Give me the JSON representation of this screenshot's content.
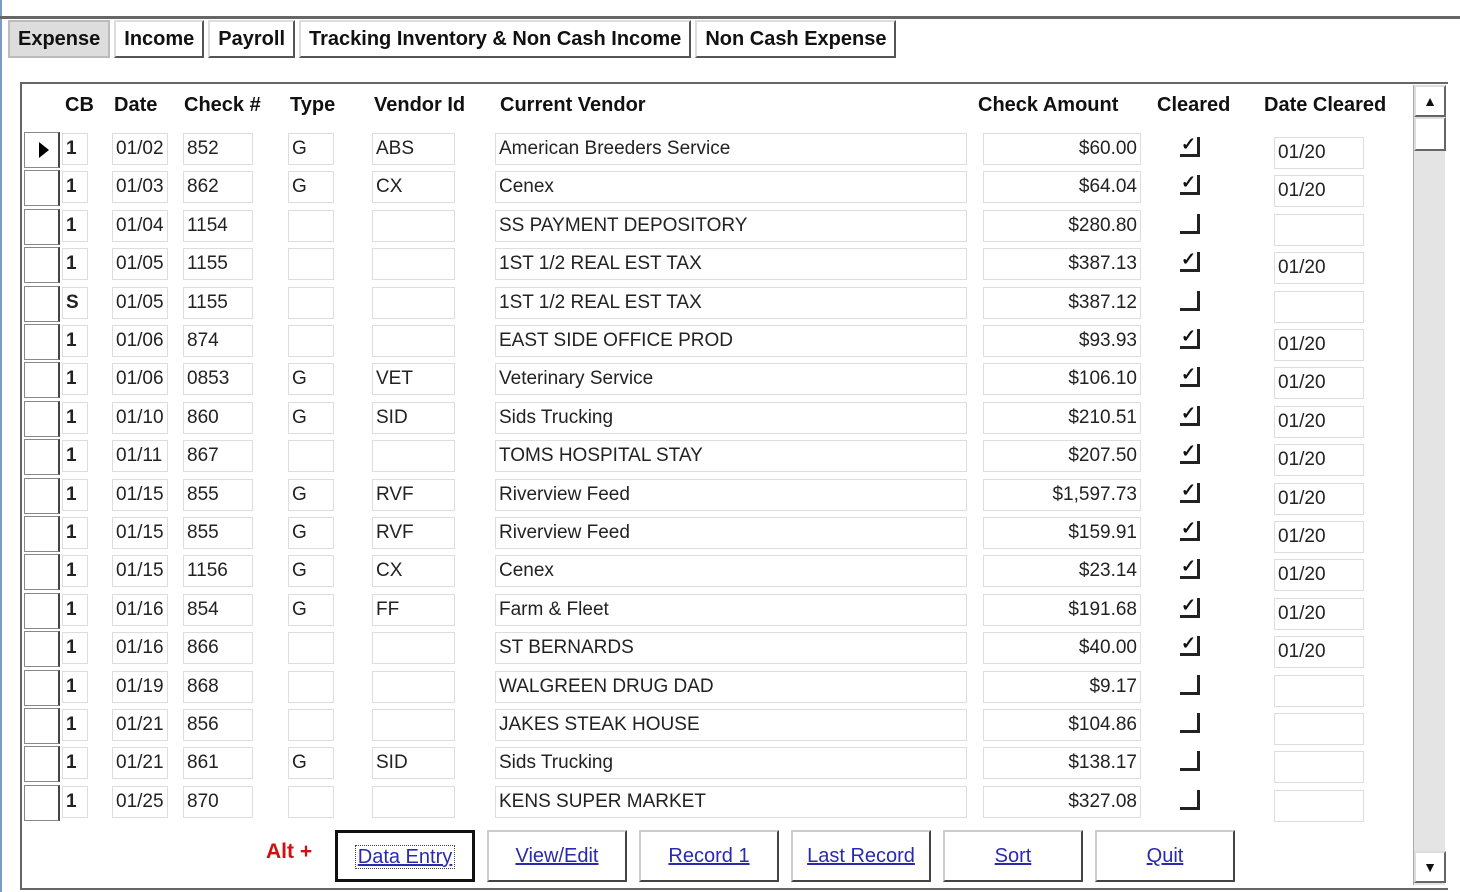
{
  "tabs": [
    "Expense",
    "Income",
    "Payroll",
    "Tracking Inventory & Non Cash Income",
    "Non Cash Expense"
  ],
  "columns": [
    "CB",
    "Date",
    "Check #",
    "Type",
    "Vendor Id",
    "Current Vendor",
    "Check Amount",
    "Cleared",
    "Date Cleared"
  ],
  "rows": [
    {
      "cb": "1",
      "date": "01/02",
      "check": "852",
      "type": "G",
      "vendor_id": "ABS",
      "vendor": "American Breeders Service",
      "amount": "$60.00",
      "cleared": true,
      "date_cleared": "01/20"
    },
    {
      "cb": "1",
      "date": "01/03",
      "check": "862",
      "type": "G",
      "vendor_id": "CX",
      "vendor": "Cenex",
      "amount": "$64.04",
      "cleared": true,
      "date_cleared": "01/20"
    },
    {
      "cb": "1",
      "date": "01/04",
      "check": "1154",
      "type": "",
      "vendor_id": "",
      "vendor": "SS PAYMENT DEPOSITORY",
      "amount": "$280.80",
      "cleared": false,
      "date_cleared": ""
    },
    {
      "cb": "1",
      "date": "01/05",
      "check": "1155",
      "type": "",
      "vendor_id": "",
      "vendor": "1ST 1/2 REAL EST TAX",
      "amount": "$387.13",
      "cleared": true,
      "date_cleared": "01/20"
    },
    {
      "cb": "S",
      "date": "01/05",
      "check": "1155",
      "type": "",
      "vendor_id": "",
      "vendor": "1ST 1/2 REAL EST TAX",
      "amount": "$387.12",
      "cleared": false,
      "date_cleared": ""
    },
    {
      "cb": "1",
      "date": "01/06",
      "check": "874",
      "type": "",
      "vendor_id": "",
      "vendor": "EAST SIDE OFFICE PROD",
      "amount": "$93.93",
      "cleared": true,
      "date_cleared": "01/20"
    },
    {
      "cb": "1",
      "date": "01/06",
      "check": "0853",
      "type": "G",
      "vendor_id": "VET",
      "vendor": "Veterinary Service",
      "amount": "$106.10",
      "cleared": true,
      "date_cleared": "01/20"
    },
    {
      "cb": "1",
      "date": "01/10",
      "check": "860",
      "type": "G",
      "vendor_id": "SID",
      "vendor": "Sids Trucking",
      "amount": "$210.51",
      "cleared": true,
      "date_cleared": "01/20"
    },
    {
      "cb": "1",
      "date": "01/11",
      "check": "867",
      "type": "",
      "vendor_id": "",
      "vendor": "TOMS HOSPITAL STAY",
      "amount": "$207.50",
      "cleared": true,
      "date_cleared": "01/20"
    },
    {
      "cb": "1",
      "date": "01/15",
      "check": "855",
      "type": "G",
      "vendor_id": "RVF",
      "vendor": "Riverview Feed",
      "amount": "$1,597.73",
      "cleared": true,
      "date_cleared": "01/20"
    },
    {
      "cb": "1",
      "date": "01/15",
      "check": "855",
      "type": "G",
      "vendor_id": "RVF",
      "vendor": "Riverview Feed",
      "amount": "$159.91",
      "cleared": true,
      "date_cleared": "01/20"
    },
    {
      "cb": "1",
      "date": "01/15",
      "check": "1156",
      "type": "G",
      "vendor_id": "CX",
      "vendor": "Cenex",
      "amount": "$23.14",
      "cleared": true,
      "date_cleared": "01/20"
    },
    {
      "cb": "1",
      "date": "01/16",
      "check": "854",
      "type": "G",
      "vendor_id": "FF",
      "vendor": "Farm & Fleet",
      "amount": "$191.68",
      "cleared": true,
      "date_cleared": "01/20"
    },
    {
      "cb": "1",
      "date": "01/16",
      "check": "866",
      "type": "",
      "vendor_id": "",
      "vendor": "ST BERNARDS",
      "amount": "$40.00",
      "cleared": true,
      "date_cleared": "01/20"
    },
    {
      "cb": "1",
      "date": "01/19",
      "check": "868",
      "type": "",
      "vendor_id": "",
      "vendor": "WALGREEN DRUG DAD",
      "amount": "$9.17",
      "cleared": false,
      "date_cleared": ""
    },
    {
      "cb": "1",
      "date": "01/21",
      "check": "856",
      "type": "",
      "vendor_id": "",
      "vendor": "JAKES STEAK HOUSE",
      "amount": "$104.86",
      "cleared": false,
      "date_cleared": ""
    },
    {
      "cb": "1",
      "date": "01/21",
      "check": "861",
      "type": "G",
      "vendor_id": "SID",
      "vendor": "Sids Trucking",
      "amount": "$138.17",
      "cleared": false,
      "date_cleared": ""
    },
    {
      "cb": "1",
      "date": "01/25",
      "check": "870",
      "type": "",
      "vendor_id": "",
      "vendor": "KENS SUPER MARKET",
      "amount": "$327.08",
      "cleared": false,
      "date_cleared": ""
    }
  ],
  "footer": {
    "alt_label": "Alt +",
    "buttons": [
      "Data Entry",
      "View/Edit",
      "Record 1",
      "Last Record",
      "Sort",
      "Quit"
    ]
  }
}
